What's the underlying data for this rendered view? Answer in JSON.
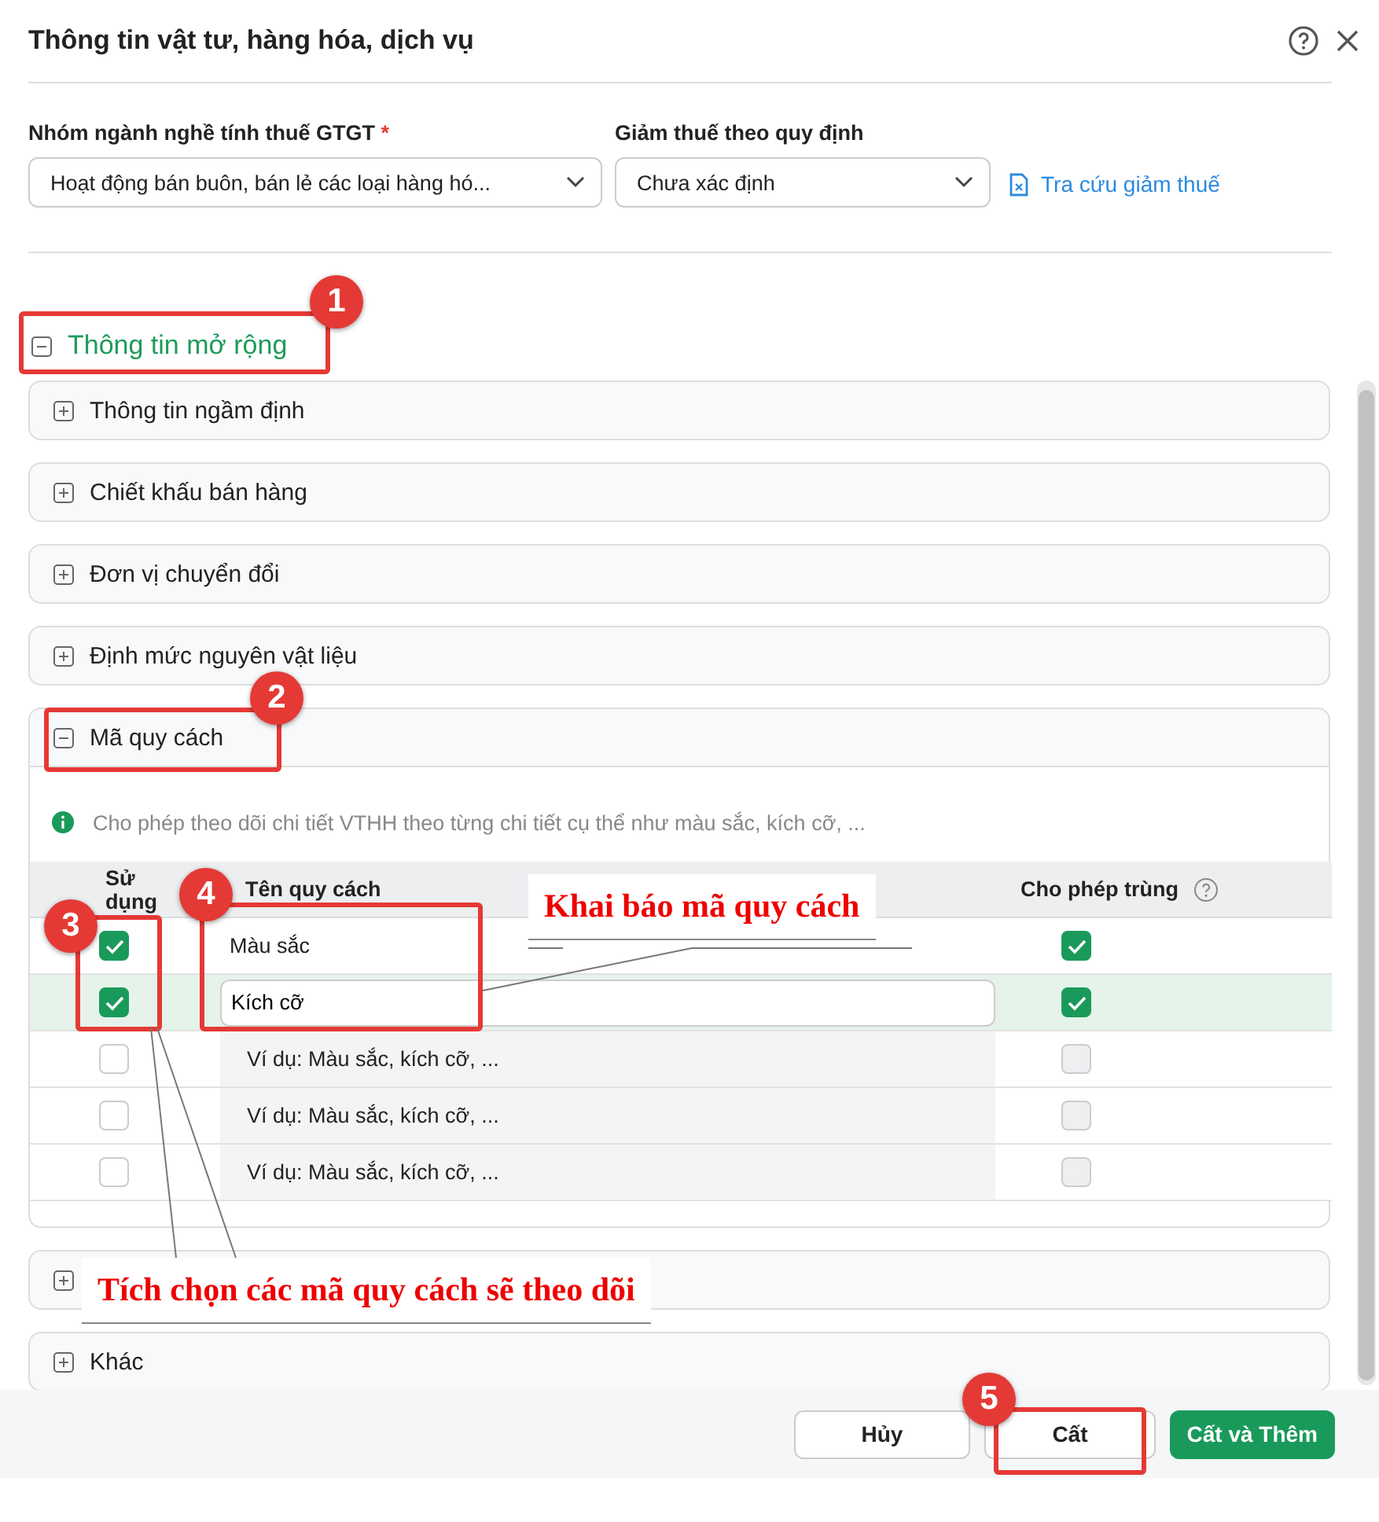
{
  "dialog": {
    "title": "Thông tin vật tư, hàng hóa, dịch vụ"
  },
  "fields": [
    {
      "label": "Nhóm ngành nghề tính thuế GTGT",
      "required": true,
      "value": "Hoạt động bán buôn, bán lẻ các loại hàng hó..."
    },
    {
      "label": "Giảm thuế theo quy định",
      "required": false,
      "value": "Chưa xác định"
    }
  ],
  "required_mark": "*",
  "lookup_link": "Tra cứu giảm thuế",
  "extended_section": {
    "title": "Thông tin mở rộng",
    "expanded": true
  },
  "panels": [
    {
      "title": "Thông tin ngầm định",
      "expanded": false
    },
    {
      "title": "Chiết khấu bán hàng",
      "expanded": false
    },
    {
      "title": "Đơn vị chuyển đổi",
      "expanded": false
    },
    {
      "title": "Định mức nguyên vật liệu",
      "expanded": false
    },
    {
      "title": "Mã quy cách",
      "expanded": true
    },
    {
      "expanded": false
    },
    {
      "title": "Khác",
      "expanded": false
    }
  ],
  "spec_info": "Cho phép theo dõi chi tiết VTHH theo từng chi tiết cụ thể như màu sắc, kích cỡ, ...",
  "spec_table": {
    "columns": [
      "Sử dụng",
      "Tên quy cách",
      "Cho phép trùng"
    ],
    "rows": [
      {
        "used": true,
        "name": "Màu sắc",
        "allow_duplicate": true,
        "selected": false,
        "kind": "text"
      },
      {
        "used": true,
        "name": "Kích cỡ",
        "allow_duplicate": true,
        "selected": true,
        "kind": "input"
      },
      {
        "used": false,
        "placeholder": "Ví dụ: Màu sắc, kích cỡ, ...",
        "allow_duplicate": false,
        "selected": false,
        "kind": "empty"
      },
      {
        "used": false,
        "placeholder": "Ví dụ: Màu sắc, kích cỡ, ...",
        "allow_duplicate": false,
        "selected": false,
        "kind": "empty"
      },
      {
        "used": false,
        "placeholder": "Ví dụ: Màu sắc, kích cỡ, ...",
        "allow_duplicate": false,
        "selected": false,
        "kind": "empty"
      }
    ]
  },
  "buttons": [
    {
      "label": "Hủy",
      "kind": "secondary"
    },
    {
      "label": "Cất",
      "kind": "secondary"
    },
    {
      "label": "Cất và Thêm",
      "kind": "primary"
    }
  ],
  "annotations": {
    "badges": [
      "1",
      "2",
      "3",
      "4",
      "5"
    ],
    "callouts": [
      "Khai báo mã quy cách",
      "Tích chọn các mã quy cách sẽ theo dõi"
    ]
  }
}
